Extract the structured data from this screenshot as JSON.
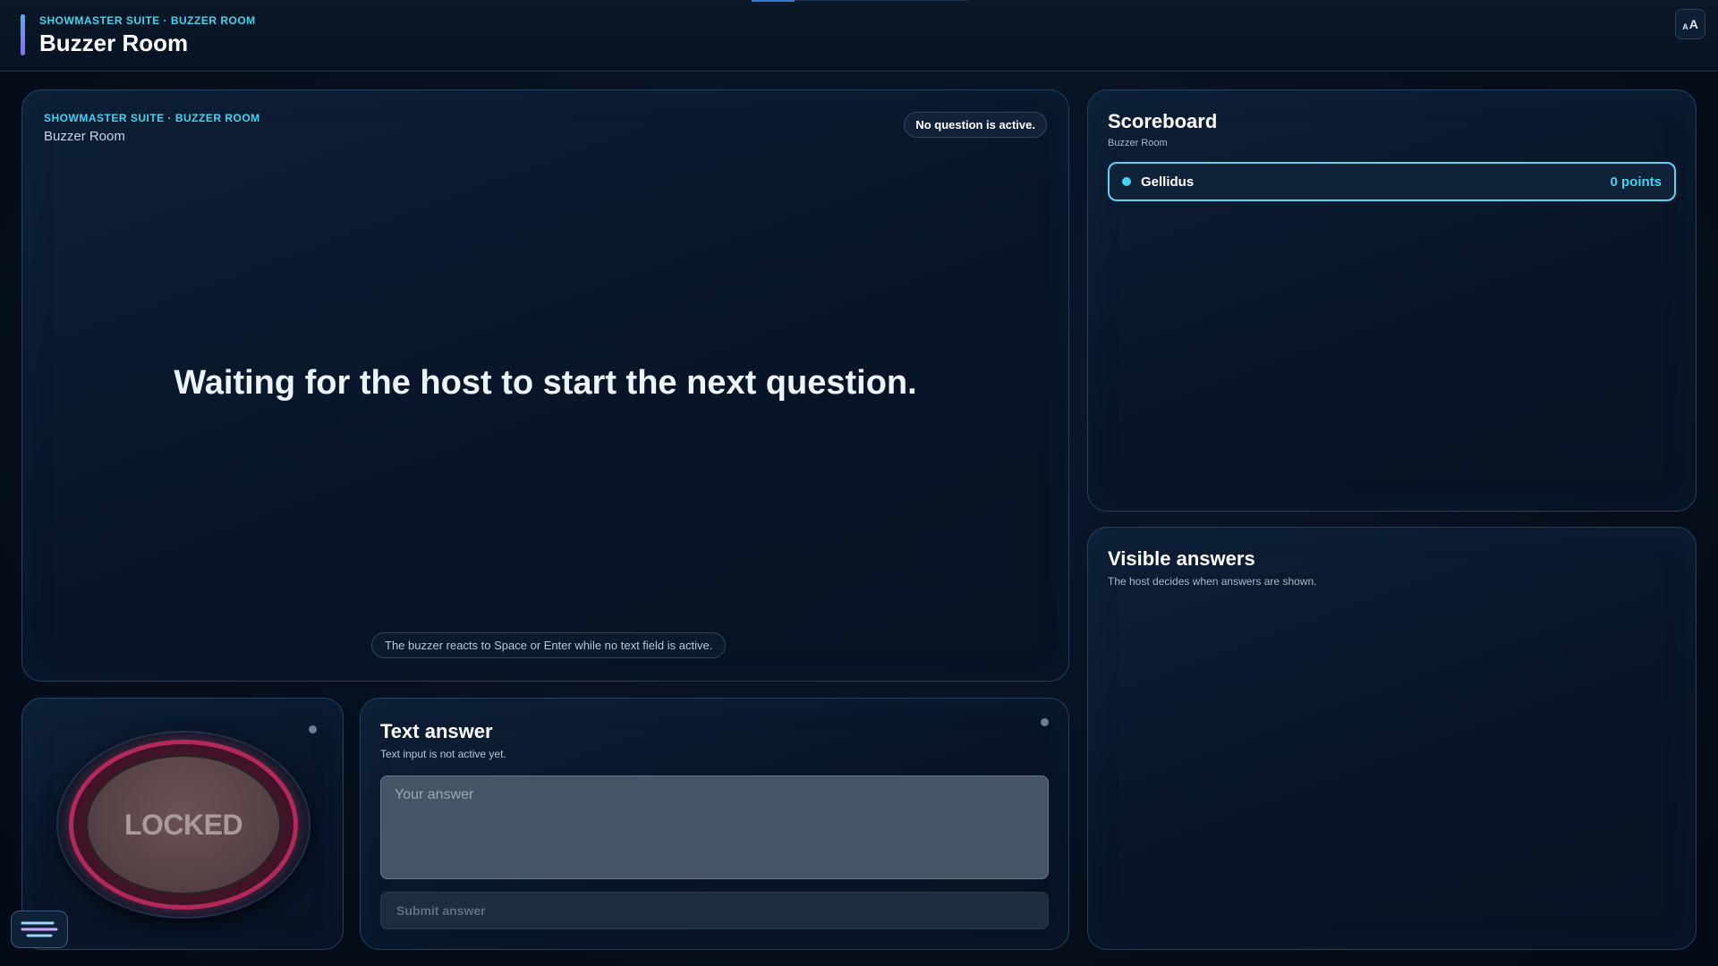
{
  "header": {
    "kicker": "SHOWMASTER SUITE · BUZZER ROOM",
    "title": "Buzzer Room",
    "font_toggle_small": "A",
    "font_toggle_big": "A"
  },
  "question": {
    "kicker": "SHOWMASTER SUITE · BUZZER ROOM",
    "subtitle": "Buzzer Room",
    "status": "No question is active.",
    "text": "Waiting for the host to start the next question.",
    "hint": "The buzzer reacts to Space or Enter while no text field is active."
  },
  "buzzer": {
    "label": "LOCKED"
  },
  "answer": {
    "heading": "Text answer",
    "subtitle": "Text input is not active yet.",
    "placeholder": "Your answer",
    "submit_label": "Submit answer"
  },
  "scoreboard": {
    "heading": "Scoreboard",
    "subtitle": "Buzzer Room",
    "players": [
      {
        "name": "Gellidus",
        "points": "0 points"
      }
    ]
  },
  "visible_answers": {
    "heading": "Visible answers",
    "subtitle": "The host decides when answers are shown."
  },
  "colors": {
    "accent": "#46d3f0",
    "buzzer_ring": "#b32a5a",
    "background": "#060f1d"
  },
  "icons": {
    "chat": "chat-bubble-icon",
    "font_size": "font-size-icon"
  }
}
